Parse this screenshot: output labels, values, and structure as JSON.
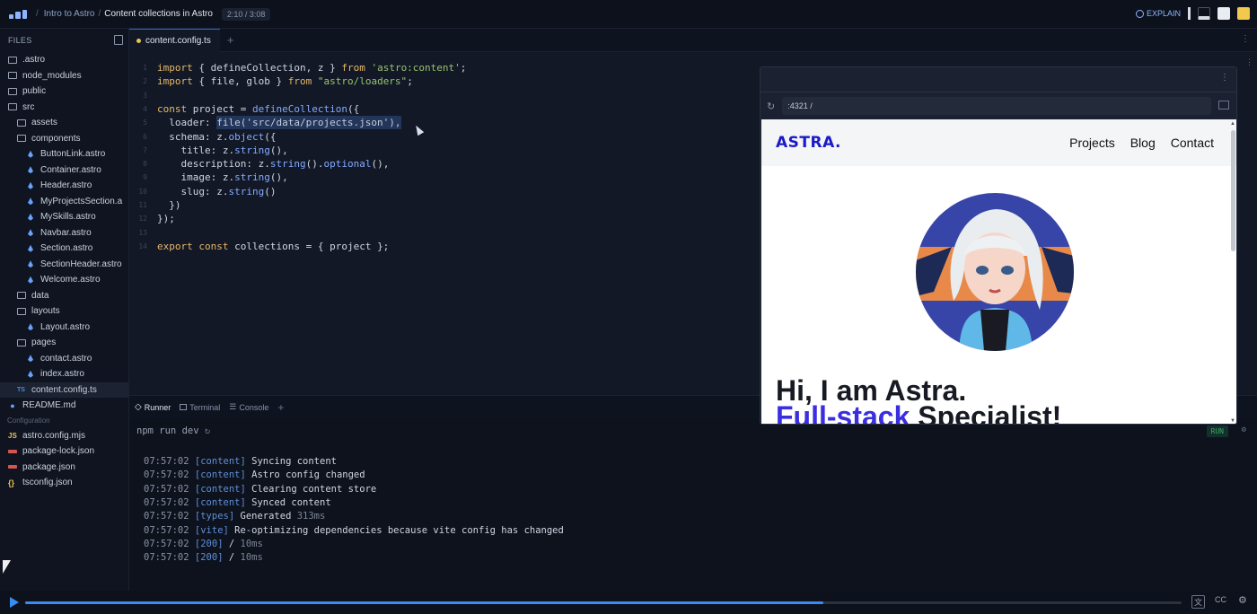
{
  "breadcrumb": {
    "course": "Intro to Astro",
    "lesson": "Content collections in Astro",
    "timer": "2:10 / 3:08"
  },
  "topbar": {
    "explain_label": "EXPLAIN"
  },
  "sidebar": {
    "header": "FILES",
    "items": [
      {
        "label": ".astro",
        "type": "folder",
        "depth": 0
      },
      {
        "label": "node_modules",
        "type": "folder",
        "depth": 0
      },
      {
        "label": "public",
        "type": "folder",
        "depth": 0
      },
      {
        "label": "src",
        "type": "folder-open",
        "depth": 0
      },
      {
        "label": "assets",
        "type": "folder",
        "depth": 1
      },
      {
        "label": "components",
        "type": "folder-open",
        "depth": 1
      },
      {
        "label": "ButtonLink.astro",
        "type": "astro",
        "depth": 2
      },
      {
        "label": "Container.astro",
        "type": "astro",
        "depth": 2
      },
      {
        "label": "Header.astro",
        "type": "astro",
        "depth": 2
      },
      {
        "label": "MyProjectsSection.a",
        "type": "astro",
        "depth": 2
      },
      {
        "label": "MySkills.astro",
        "type": "astro",
        "depth": 2
      },
      {
        "label": "Navbar.astro",
        "type": "astro",
        "depth": 2
      },
      {
        "label": "Section.astro",
        "type": "astro",
        "depth": 2
      },
      {
        "label": "SectionHeader.astro",
        "type": "astro",
        "depth": 2
      },
      {
        "label": "Welcome.astro",
        "type": "astro",
        "depth": 2
      },
      {
        "label": "data",
        "type": "folder",
        "depth": 1
      },
      {
        "label": "layouts",
        "type": "folder-open",
        "depth": 1
      },
      {
        "label": "Layout.astro",
        "type": "astro",
        "depth": 2
      },
      {
        "label": "pages",
        "type": "folder-open",
        "depth": 1
      },
      {
        "label": "contact.astro",
        "type": "astro",
        "depth": 2
      },
      {
        "label": "index.astro",
        "type": "astro",
        "depth": 2
      },
      {
        "label": "content.config.ts",
        "type": "ts",
        "depth": 1,
        "active": true
      },
      {
        "label": "README.md",
        "type": "md",
        "depth": 0
      }
    ],
    "config_label": "Configuration",
    "config_items": [
      {
        "label": "astro.config.mjs",
        "type": "js"
      },
      {
        "label": "package-lock.json",
        "type": "json"
      },
      {
        "label": "package.json",
        "type": "json"
      },
      {
        "label": "tsconfig.json",
        "type": "brace"
      }
    ]
  },
  "editor": {
    "tab_label": "content.config.ts",
    "lines": [
      {
        "n": "1",
        "tokens": [
          [
            "kw",
            "import"
          ],
          [
            "pl",
            " { defineCollection, z } "
          ],
          [
            "kw",
            "from"
          ],
          [
            "str",
            " 'astro:content'"
          ],
          [
            "pl",
            ";"
          ]
        ]
      },
      {
        "n": "2",
        "tokens": [
          [
            "kw",
            "import"
          ],
          [
            "pl",
            " { file, glob } "
          ],
          [
            "kw",
            "from"
          ],
          [
            "str",
            " \"astro/loaders\""
          ],
          [
            "pl",
            ";"
          ]
        ]
      },
      {
        "n": "3",
        "tokens": []
      },
      {
        "n": "4",
        "tokens": [
          [
            "kw",
            "const"
          ],
          [
            "pl",
            " project = "
          ],
          [
            "fn",
            "defineCollection"
          ],
          [
            "pl",
            "({"
          ]
        ]
      },
      {
        "n": "5",
        "tokens": [
          [
            "pl",
            "  loader: "
          ],
          [
            "sel",
            "file('src/data/projects.json'),"
          ]
        ]
      },
      {
        "n": "6",
        "tokens": [
          [
            "pl",
            "  schema: z."
          ],
          [
            "fn",
            "object"
          ],
          [
            "pl",
            "({"
          ]
        ]
      },
      {
        "n": "7",
        "tokens": [
          [
            "pl",
            "    title: z."
          ],
          [
            "fn",
            "string"
          ],
          [
            "pl",
            "(),"
          ]
        ]
      },
      {
        "n": "8",
        "tokens": [
          [
            "pl",
            "    description: z."
          ],
          [
            "fn",
            "string"
          ],
          [
            "pl",
            "()."
          ],
          [
            "fn",
            "optional"
          ],
          [
            "pl",
            "(),"
          ]
        ]
      },
      {
        "n": "9",
        "tokens": [
          [
            "pl",
            "    image: z."
          ],
          [
            "fn",
            "string"
          ],
          [
            "pl",
            "(),"
          ]
        ]
      },
      {
        "n": "10",
        "tokens": [
          [
            "pl",
            "    slug: z."
          ],
          [
            "fn",
            "string"
          ],
          [
            "pl",
            "()"
          ]
        ]
      },
      {
        "n": "11",
        "tokens": [
          [
            "pl",
            "  })"
          ]
        ]
      },
      {
        "n": "12",
        "tokens": [
          [
            "pl",
            "});"
          ]
        ]
      },
      {
        "n": "13",
        "tokens": []
      },
      {
        "n": "14",
        "tokens": [
          [
            "kw",
            "export"
          ],
          [
            "kw",
            " const"
          ],
          [
            "pl",
            " collections = { project };"
          ]
        ]
      }
    ]
  },
  "panel": {
    "tabs": [
      "Runner",
      "Terminal",
      "Console"
    ],
    "command": "npm run dev",
    "run_label": "RUN",
    "log": [
      {
        "time": "07:57:02",
        "tag": "[content]",
        "msg": " Syncing content",
        "extra": ""
      },
      {
        "time": "07:57:02",
        "tag": "[content]",
        "msg": " Astro config changed",
        "extra": ""
      },
      {
        "time": "07:57:02",
        "tag": "[content]",
        "msg": " Clearing content store",
        "extra": ""
      },
      {
        "time": "07:57:02",
        "tag": "[content]",
        "msg": " Synced content",
        "extra": ""
      },
      {
        "time": "07:57:02",
        "tag": "[types]",
        "msg": " Generated",
        "extra": " 313ms"
      },
      {
        "time": "07:57:02",
        "tag": "[vite]",
        "msg": " Re-optimizing dependencies because vite config has changed",
        "extra": ""
      },
      {
        "time": "07:57:02",
        "tag": "[200]",
        "msg": " /",
        "extra": " 10ms"
      },
      {
        "time": "07:57:02",
        "tag": "[200]",
        "msg": " /",
        "extra": " 10ms"
      }
    ]
  },
  "preview": {
    "url": ":4321 /",
    "site": {
      "logo": "ASTRA.",
      "nav": [
        "Projects",
        "Blog",
        "Contact"
      ],
      "hero_line1": "Hi, I am Astra.",
      "hero_accent": "Full-stack",
      "hero_rest": " Specialist!"
    }
  },
  "player": {
    "progress": 0.69,
    "cc_label": "CC"
  },
  "colors": {
    "accent": "#3b8cf0",
    "brand": "#1a1ac8",
    "hero_accent": "#3a2ee0"
  }
}
